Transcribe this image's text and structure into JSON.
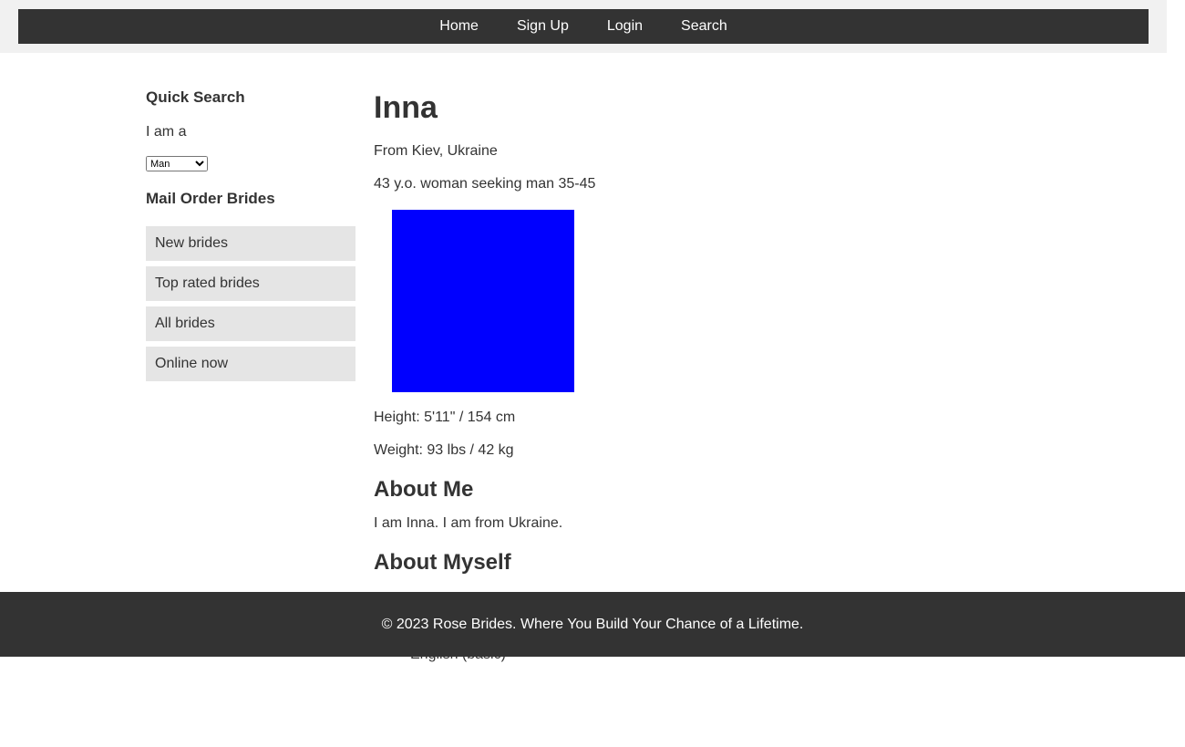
{
  "nav": {
    "items": [
      {
        "label": "Home"
      },
      {
        "label": "Sign Up"
      },
      {
        "label": "Login"
      },
      {
        "label": "Search"
      }
    ]
  },
  "sidebar": {
    "quick_search_title": "Quick Search",
    "iam_label": "I am a",
    "gender_select_value": "Man",
    "mob_title": "Mail Order Brides",
    "links": [
      {
        "label": "New brides"
      },
      {
        "label": "Top rated brides"
      },
      {
        "label": "All brides"
      },
      {
        "label": "Online now"
      }
    ]
  },
  "profile": {
    "name": "Inna",
    "from": "From Kiev, Ukraine",
    "seeking": "43 y.o. woman seeking man 35-45",
    "photo_color": "#0000ff",
    "height": "Height: 5'11\" / 154 cm",
    "weight": "Weight: 93 lbs / 42 kg",
    "about_me_title": "About Me",
    "about_me_text": "I am Inna. I am from Ukraine.",
    "about_myself_title": "About Myself",
    "languages": [
      "English (basic)"
    ]
  },
  "footer": {
    "text": "© 2023 Rose Brides. Where You Build Your Chance of a Lifetime."
  },
  "colors": {
    "nav_bg": "#333333",
    "header_bg": "#f1f1f1",
    "sidebar_item_bg": "#e5e5e5",
    "text": "#333333"
  }
}
